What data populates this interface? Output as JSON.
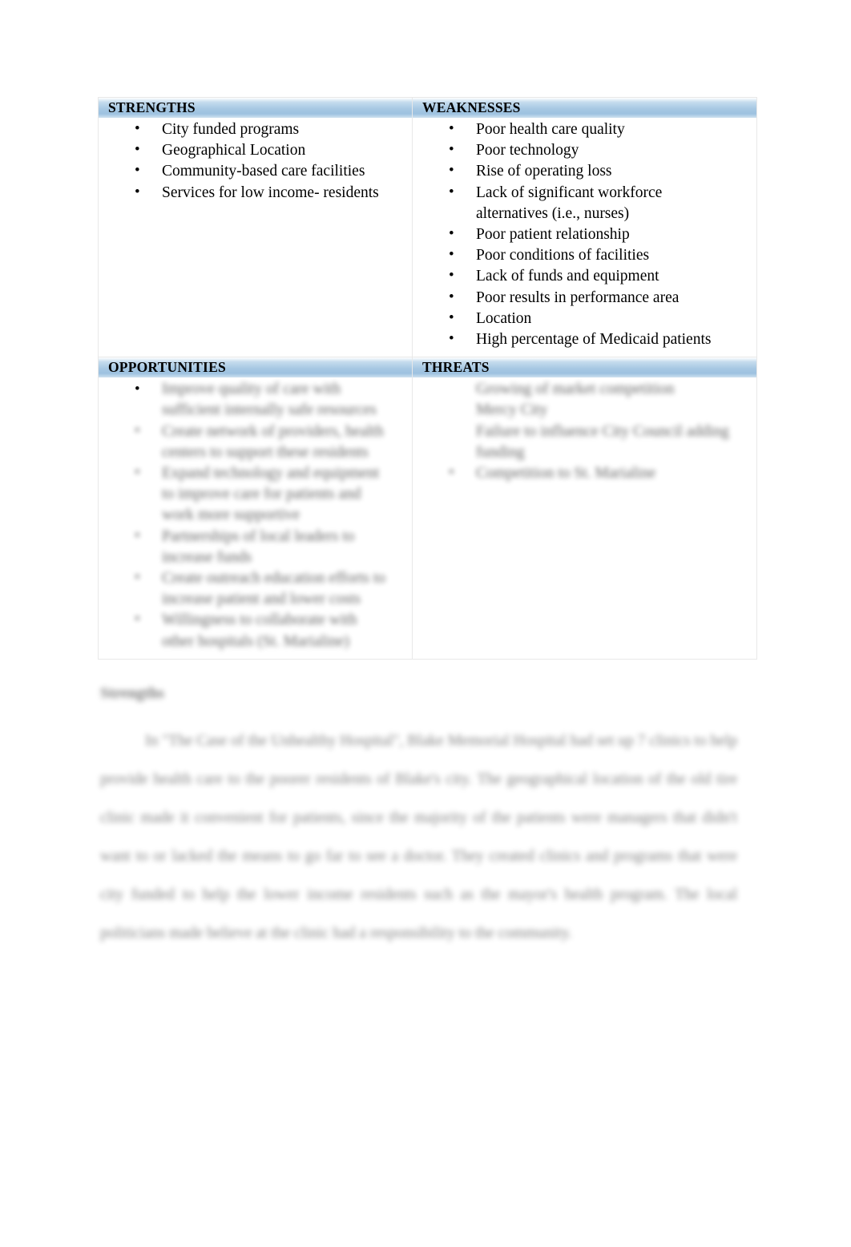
{
  "document": {
    "type": "swot-analysis",
    "page_background": "#ffffff",
    "header_band_color": "#a7c8e3",
    "border_color": "#e8e8e8"
  },
  "swot": {
    "strengths": {
      "title": "STRENGTHS",
      "items": [
        "City funded programs",
        "Geographical Location",
        "Community-based care facilities",
        "Services for low income- residents"
      ]
    },
    "weaknesses": {
      "title": "WEAKNESSES",
      "items": [
        "Poor health care quality",
        "Poor technology",
        "Rise of operating loss",
        "Lack of significant workforce",
        "alternatives (i.e., nurses)",
        "Poor patient relationship",
        "Poor conditions of facilities",
        "Lack of funds and equipment",
        "Poor results in performance area",
        "Location",
        "High percentage of Medicaid patients"
      ],
      "continuation_indexes": [
        4
      ]
    },
    "opportunities": {
      "title": "OPPORTUNITIES",
      "blurred": true,
      "items": [
        "Improve quality of care with",
        "sufficient internally safe resources",
        "Create network of providers, health",
        "centers to support these residents",
        "Expand technology and equipment",
        "to improve care for patients and",
        "work more supportive",
        "Partnerships of local leaders to",
        "increase funds",
        "Create outreach education efforts to",
        "increase patient and lower costs",
        "Willingness to collaborate with",
        "other hospitals (St. Marialine)"
      ]
    },
    "threats": {
      "title": "THREATS",
      "blurred": true,
      "items": [
        "Growing of market competition",
        "Mercy City",
        "Failure to influence City Council adding",
        "funding",
        "Competition to St. Marialine"
      ]
    }
  },
  "prose": {
    "heading": "Strengths",
    "blurred": true,
    "paragraphs": [
      "In \"The Case of the Unhealthy Hospital\", Blake Memorial Hospital had set up 7 clinics to help provide health care to the poorer residents of Blake's city. The geographical location of the old tire clinic made it convenient for patients, since the majority of the patients were managers that didn't want to or lacked the means to go far to see a doctor. They created clinics and programs that were city funded to help the lower income residents such as the mayor's health program. The local politicians made believe at the clinic had a responsibility to the community."
    ]
  }
}
